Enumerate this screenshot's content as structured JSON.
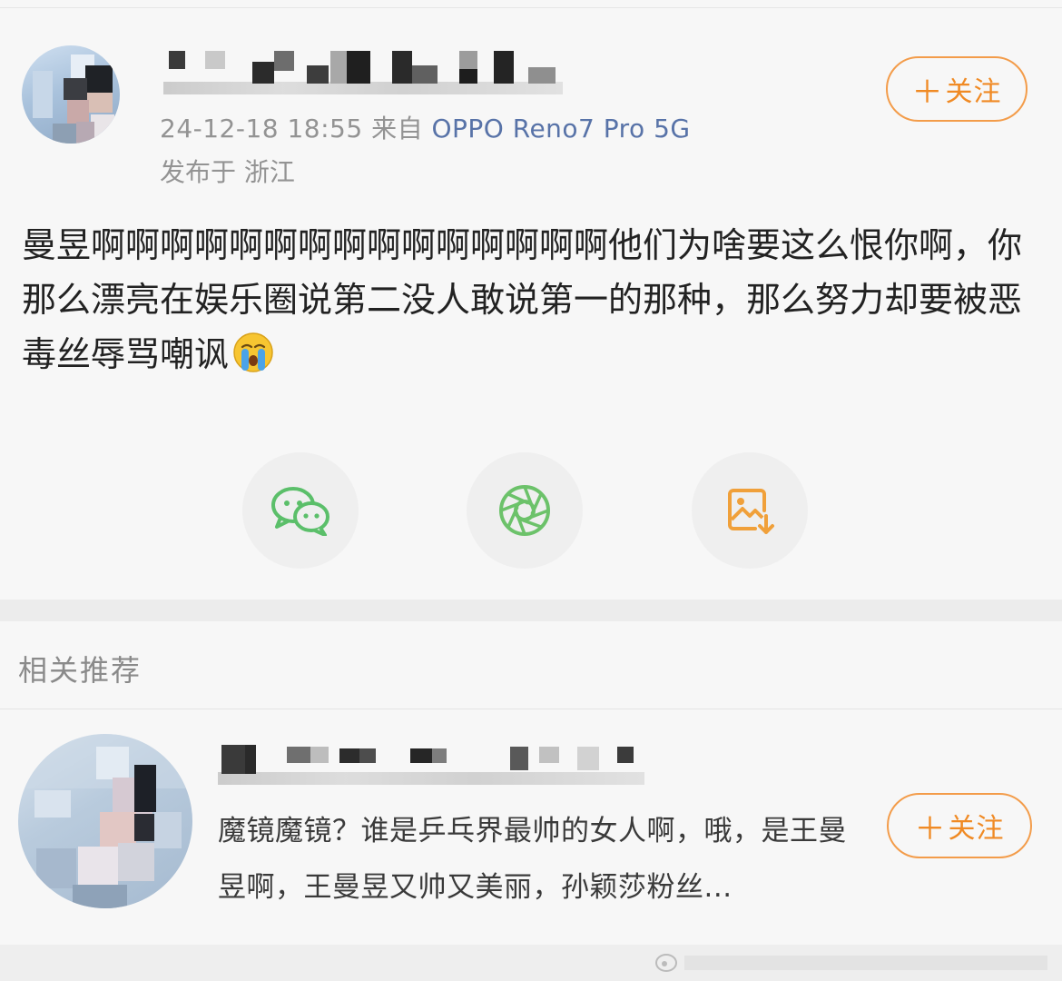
{
  "post": {
    "timestamp": "24-12-18 18:55",
    "via_prefix": " 来自 ",
    "device": "OPPO Reno7 Pro 5G",
    "location": "发布于 浙江",
    "follow_label": "关注",
    "follow_plus": "＋",
    "content": "曼昱啊啊啊啊啊啊啊啊啊啊啊啊啊啊啊他们为啥要这么恨你啊，你那么漂亮在娱乐圈说第二没人敢说第一的那种，那么努力却要被恶毒丝辱骂嘲讽",
    "emoji": "crying-face-icon"
  },
  "share": {
    "items": [
      {
        "icon": "wechat-icon",
        "color": "#5bbf6a"
      },
      {
        "icon": "moments-icon",
        "color": "#6cc26a"
      },
      {
        "icon": "save-image-icon",
        "color": "#f0a03a"
      }
    ]
  },
  "related": {
    "title": "相关推荐",
    "items": [
      {
        "text": "魔镜魔镜？谁是乒乓界最帅的女人啊，哦，是王曼昱啊，王曼昱又帅又美丽，孙颖莎粉丝...",
        "follow_label": "关注",
        "follow_plus": "＋"
      }
    ]
  },
  "colors": {
    "accent": "#f08a24",
    "link": "#5873a8",
    "background": "#f7f7f7"
  }
}
